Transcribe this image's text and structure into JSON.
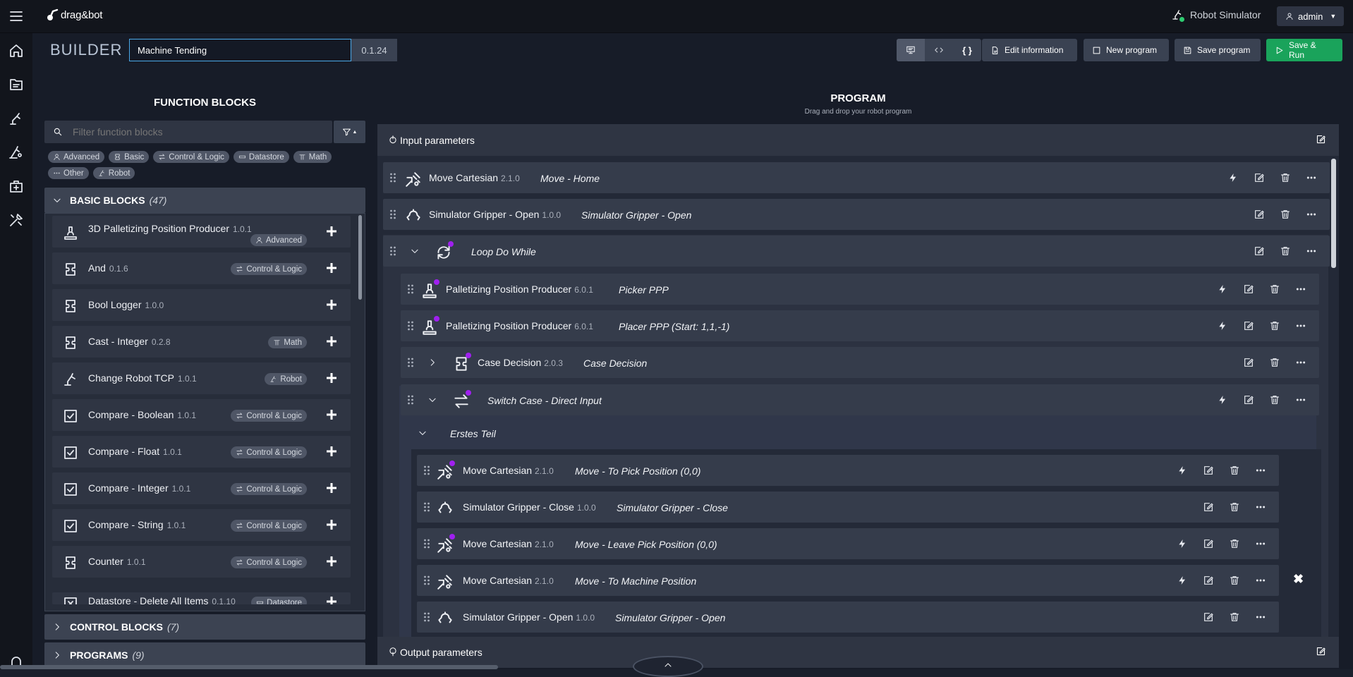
{
  "app": {
    "logo_text": "drag&bot",
    "robot_label": "Robot Simulator",
    "user_label": "admin"
  },
  "builder": {
    "title": "BUILDER",
    "program_name": "Machine Tending",
    "version": "0.1.24"
  },
  "toolbar": {
    "edit_info": "Edit information",
    "new_program": "New program",
    "save_program": "Save program",
    "save_run": "Save & Run"
  },
  "function_blocks": {
    "title": "FUNCTION BLOCKS",
    "filter_placeholder": "Filter function blocks",
    "filter_tags": [
      {
        "label": "Advanced",
        "icon": "person-icon"
      },
      {
        "label": "Basic",
        "icon": "block-icon"
      },
      {
        "label": "Control & Logic",
        "icon": "arrows-icon"
      },
      {
        "label": "Datastore",
        "icon": "datastore-icon"
      },
      {
        "label": "Math",
        "icon": "pi-icon"
      },
      {
        "label": "Other",
        "icon": "dots-icon"
      },
      {
        "label": "Robot",
        "icon": "robot-arm-icon"
      }
    ],
    "categories": [
      {
        "name": "BASIC BLOCKS",
        "count": "(47)"
      },
      {
        "name": "CONTROL BLOCKS",
        "count": "(7)"
      },
      {
        "name": "PROGRAMS",
        "count": "(9)"
      }
    ],
    "blocks": [
      {
        "name": "3D Palletizing Position Producer",
        "version": "1.0.1",
        "tag": "Advanced",
        "icon": "palletizer-icon"
      },
      {
        "name": "And",
        "version": "0.1.6",
        "tag": "Control & Logic",
        "icon": "block-icon"
      },
      {
        "name": "Bool Logger",
        "version": "1.0.0",
        "tag": "",
        "icon": "block-icon"
      },
      {
        "name": "Cast - Integer",
        "version": "0.2.8",
        "tag": "Math",
        "icon": "block-icon"
      },
      {
        "name": "Change Robot TCP",
        "version": "1.0.1",
        "tag": "Robot",
        "icon": "robot-arm-icon"
      },
      {
        "name": "Compare - Boolean",
        "version": "1.0.1",
        "tag": "Control & Logic",
        "icon": "checkbox-icon"
      },
      {
        "name": "Compare - Float",
        "version": "1.0.1",
        "tag": "Control & Logic",
        "icon": "checkbox-icon"
      },
      {
        "name": "Compare - Integer",
        "version": "1.0.1",
        "tag": "Control & Logic",
        "icon": "checkbox-icon"
      },
      {
        "name": "Compare - String",
        "version": "1.0.1",
        "tag": "Control & Logic",
        "icon": "checkbox-icon"
      },
      {
        "name": "Counter",
        "version": "1.0.1",
        "tag": "Control & Logic",
        "icon": "block-icon"
      },
      {
        "name": "Datastore - Delete All Items",
        "version": "0.1.10",
        "tag": "Datastore",
        "icon": "delete-box-icon"
      }
    ]
  },
  "program": {
    "title": "PROGRAM",
    "subtitle": "Drag and drop your robot program",
    "input_params": "Input parameters",
    "output_params": "Output parameters",
    "rows": [
      {
        "name": "Move Cartesian",
        "version": "2.1.0",
        "desc": "Move - Home",
        "icon": "move-icon"
      },
      {
        "name": "Simulator Gripper - Open",
        "version": "1.0.0",
        "desc": "Simulator Gripper - Open",
        "icon": "gripper-icon"
      },
      {
        "name": "",
        "version": "",
        "desc": "Loop Do While",
        "icon": "loop-icon"
      },
      {
        "name": "Palletizing Position Producer",
        "version": "6.0.1",
        "desc": "Picker PPP",
        "icon": "palletizer-icon"
      },
      {
        "name": "Palletizing Position Producer",
        "version": "6.0.1",
        "desc": "Placer PPP  (Start: 1,1,-1)",
        "icon": "palletizer-icon"
      },
      {
        "name": "Case Decision",
        "version": "2.0.3",
        "desc": "Case Decision",
        "icon": "block-icon"
      },
      {
        "name": "",
        "version": "",
        "desc": "Switch Case - Direct Input",
        "icon": "switch-icon"
      },
      {
        "name": "",
        "version": "",
        "desc": "Erstes Teil",
        "icon": ""
      },
      {
        "name": "Move Cartesian",
        "version": "2.1.0",
        "desc": "Move - To Pick Position (0,0)",
        "icon": "move-icon"
      },
      {
        "name": "Simulator Gripper - Close",
        "version": "1.0.0",
        "desc": "Simulator Gripper - Close",
        "icon": "gripper-icon"
      },
      {
        "name": "Move Cartesian",
        "version": "2.1.0",
        "desc": "Move - Leave Pick Position (0,0)",
        "icon": "move-icon"
      },
      {
        "name": "Move Cartesian",
        "version": "2.1.0",
        "desc": "Move - To Machine Position",
        "icon": "move-icon"
      },
      {
        "name": "Simulator Gripper - Open",
        "version": "1.0.0",
        "desc": "Simulator Gripper - Open",
        "icon": "gripper-icon"
      }
    ]
  },
  "colors": {
    "accent_green": "#1aa35b",
    "purple_dot": "#a020f0",
    "bg": "#171c28"
  }
}
